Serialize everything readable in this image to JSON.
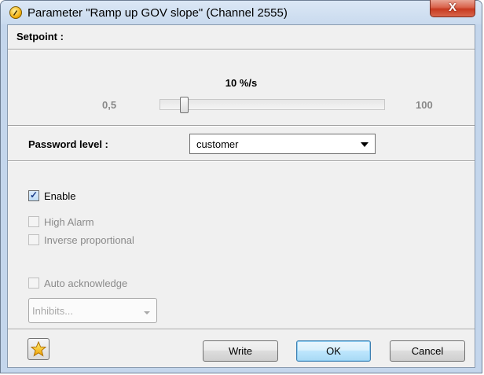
{
  "window": {
    "title": "Parameter \"Ramp up GOV slope\" (Channel 2555)",
    "close_label": "X"
  },
  "setpoint": {
    "label": "Setpoint :",
    "value_text": "10 %/s",
    "min_label": "0,5",
    "max_label": "100",
    "slider_fraction": 0.095
  },
  "password": {
    "label": "Password level :",
    "selected": "customer"
  },
  "options": {
    "enable": {
      "label": "Enable",
      "checked": true,
      "enabled": true
    },
    "high_alarm": {
      "label": "High Alarm",
      "checked": false,
      "enabled": false
    },
    "inverse": {
      "label": "Inverse proportional",
      "checked": false,
      "enabled": false
    },
    "auto_ack": {
      "label": "Auto acknowledge",
      "checked": false,
      "enabled": false
    }
  },
  "inhibits": {
    "placeholder": "Inhibits..."
  },
  "buttons": {
    "write": "Write",
    "ok": "OK",
    "cancel": "Cancel"
  },
  "icons": {
    "title": "parameter-icon",
    "favorite": "star-icon"
  }
}
